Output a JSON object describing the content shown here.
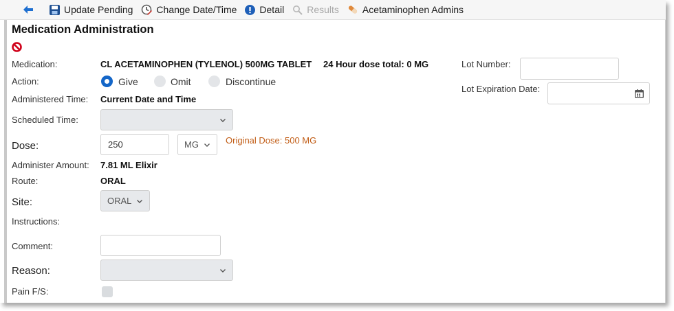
{
  "toolbar": {
    "update_pending": "Update Pending",
    "change_date_time": "Change Date/Time",
    "detail": "Detail",
    "results": "Results",
    "acetaminophen_admins": "Acetaminophen Admins"
  },
  "form": {
    "title": "Medication Administration",
    "medication": {
      "label": "Medication:",
      "value": "CL ACETAMINOPHEN (TYLENOL) 500MG TABLET",
      "dose_total": "24 Hour dose total: 0 MG"
    },
    "action": {
      "label": "Action:",
      "options": [
        "Give",
        "Omit",
        "Discontinue"
      ],
      "selected": "Give"
    },
    "administered_time": {
      "label": "Administered Time:",
      "value": "Current Date and Time"
    },
    "scheduled_time": {
      "label": "Scheduled Time:",
      "value": ""
    },
    "dose": {
      "label": "Dose:",
      "value": "250",
      "unit": "MG",
      "original": "Original Dose: 500 MG"
    },
    "administer_amount": {
      "label": "Administer Amount:",
      "value": "7.81 ML Elixir"
    },
    "route": {
      "label": "Route:",
      "value": "ORAL"
    },
    "site": {
      "label": "Site:",
      "value": "ORAL"
    },
    "instructions": {
      "label": "Instructions:"
    },
    "comment": {
      "label": "Comment:",
      "value": ""
    },
    "reason": {
      "label": "Reason:",
      "value": ""
    },
    "pain": {
      "label": "Pain F/S:"
    },
    "lot_number": {
      "label": "Lot Number:",
      "value": ""
    },
    "lot_expiration": {
      "label": "Lot Expiration Date:",
      "value": ""
    }
  },
  "colors": {
    "accent": "#1466c8",
    "original_dose": "#c15d16",
    "stop_icon": "#d0021b"
  }
}
